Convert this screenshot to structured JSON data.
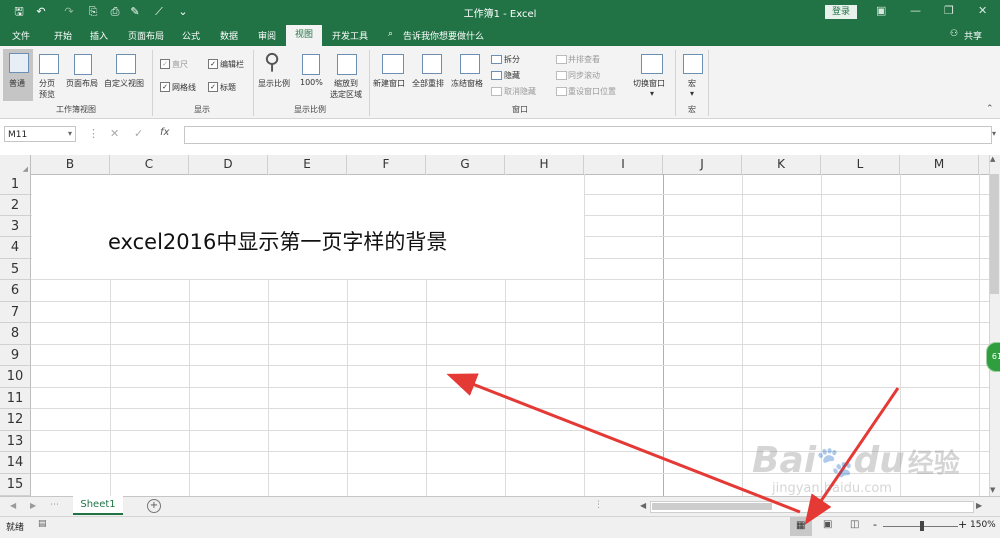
{
  "titlebar": {
    "title": "工作簿1  -  Excel",
    "login_label": "登录",
    "share_label": "共享",
    "tell_me": "告诉我你想要做什么"
  },
  "tabs": [
    "文件",
    "开始",
    "插入",
    "页面布局",
    "公式",
    "数据",
    "审阅",
    "视图",
    "开发工具"
  ],
  "active_tab": "视图",
  "ribbon": {
    "workbook_views": {
      "group_label": "工作簿视图",
      "normal": "普通",
      "page_break_line1": "分页",
      "page_break_line2": "预览",
      "page_layout": "页面布局",
      "custom_views": "自定义视图"
    },
    "show": {
      "group_label": "显示",
      "ruler": "直尺",
      "formula_bar": "编辑栏",
      "gridlines": "网格线",
      "headings": "标题"
    },
    "zoom": {
      "group_label": "显示比例",
      "zoom": "显示比例",
      "hundred": "100%",
      "zoom_sel_line1": "缩放到",
      "zoom_sel_line2": "选定区域"
    },
    "window": {
      "group_label": "窗口",
      "new_window": "新建窗口",
      "arrange_all": "全部重排",
      "freeze_panes": "冻结窗格",
      "split": "拆分",
      "hide": "隐藏",
      "unhide": "取消隐藏",
      "side_by_side": "并排查看",
      "sync_scroll": "同步滚动",
      "reset_pos": "重设窗口位置",
      "switch_windows": "切换窗口"
    },
    "macros": {
      "group_label": "宏",
      "macros": "宏"
    }
  },
  "formula_bar": {
    "name_box": "M11",
    "fx": "fx",
    "value": ""
  },
  "columns": [
    "B",
    "C",
    "D",
    "E",
    "F",
    "G",
    "H",
    "I",
    "J",
    "K",
    "L",
    "M"
  ],
  "rows": [
    "1",
    "2",
    "3",
    "4",
    "5",
    "6",
    "7",
    "8",
    "9",
    "10",
    "11",
    "12",
    "13",
    "14",
    "15"
  ],
  "cell_text": "excel2016中显示第一页字样的背景",
  "sheets": [
    "Sheet1"
  ],
  "status": {
    "ready": "就绪",
    "zoom_level": "150%",
    "zoom_minus": "-",
    "zoom_plus": "+"
  },
  "side_badge": "61",
  "watermark": {
    "brand": "Bai",
    "brand2": "du",
    "cn": "经验",
    "url": "jingyan.baidu.com"
  },
  "colors": {
    "accent": "#217346",
    "arrow": "#e53935"
  }
}
